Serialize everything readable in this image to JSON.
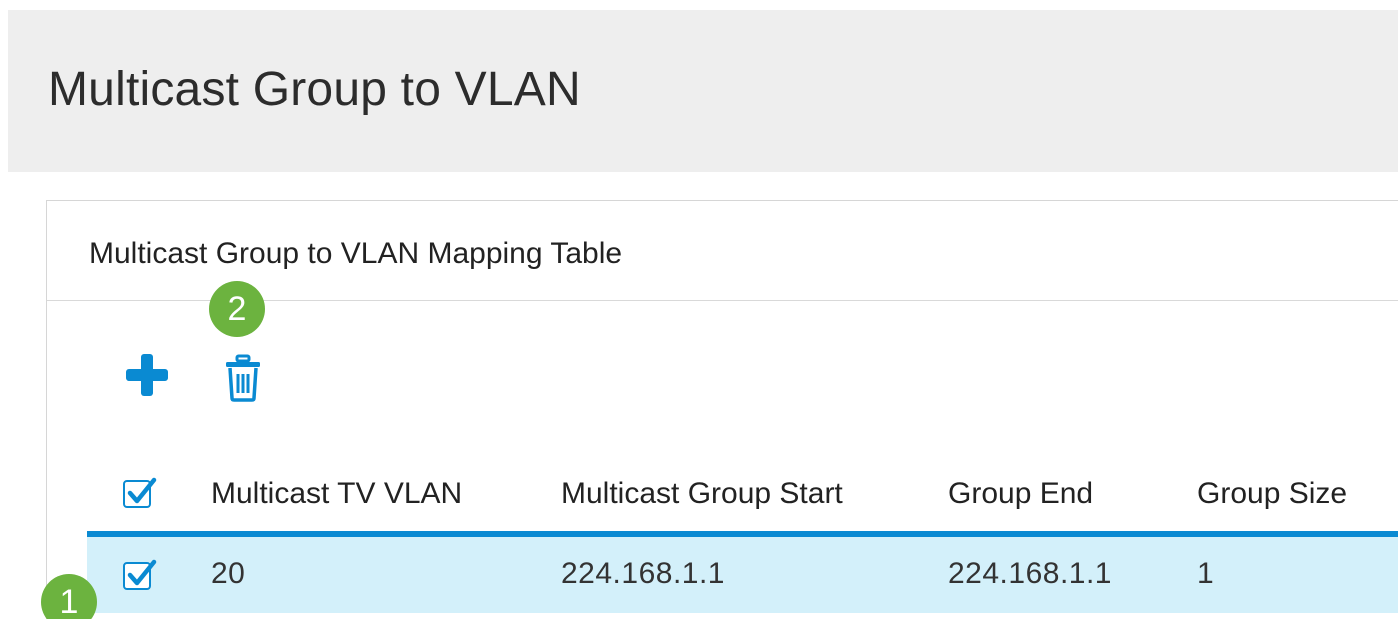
{
  "page": {
    "title": "Multicast Group to VLAN"
  },
  "card": {
    "title": "Multicast Group to VLAN Mapping Table"
  },
  "toolbar": {
    "add_icon": "plus-icon",
    "delete_icon": "trash-icon"
  },
  "annotations": {
    "step_1": "1",
    "step_2": "2"
  },
  "table": {
    "header_checkbox_checked": true,
    "columns": [
      "Multicast TV VLAN",
      "Multicast Group Start",
      "Group End",
      "Group Size"
    ],
    "rows": [
      {
        "checked": true,
        "selected": true,
        "cells": [
          "20",
          "224.168.1.1",
          "224.168.1.1",
          "1"
        ]
      }
    ]
  },
  "colors": {
    "accent": "#0a8ad2",
    "badge": "#6cb33f",
    "header_bg": "#eeeeee",
    "selected_row_bg": "#d3f0fa"
  }
}
